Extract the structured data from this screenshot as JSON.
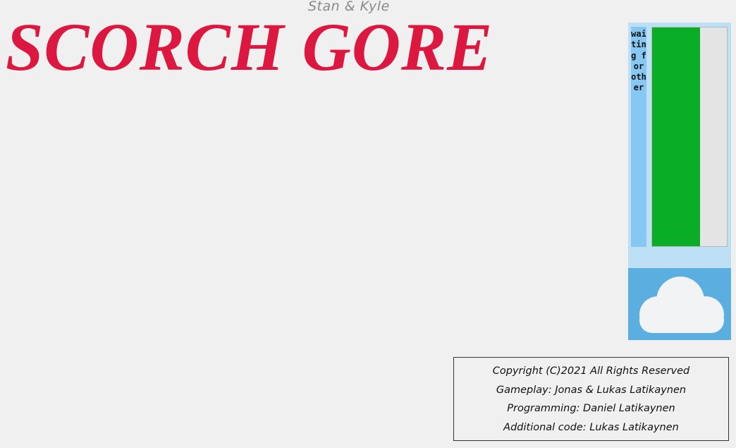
{
  "header": {
    "subtitle": "Stan & Kyle",
    "title": "SCORCH GORE"
  },
  "status_panel": {
    "status_text": "waiting for other",
    "meter_fraction": 0.64,
    "weather_icon": "cloud-icon",
    "colors": {
      "panel": "#bde0f6",
      "strip": "#86c8f3",
      "meter_fill": "#0aad26",
      "meter_track": "#e4e4e4",
      "weather_bg": "#5aaee0"
    }
  },
  "credits": {
    "lines": [
      "Copyright (C)2021 All Rights Reserved",
      "Gameplay: Jonas & Lukas Latikaynen",
      "Programming: Daniel Latikaynen",
      "Additional code: Lukas Latikaynen"
    ]
  },
  "colors": {
    "title": "#dd1840",
    "subtitle": "#8a8a8a",
    "background": "#f0f0f0"
  }
}
